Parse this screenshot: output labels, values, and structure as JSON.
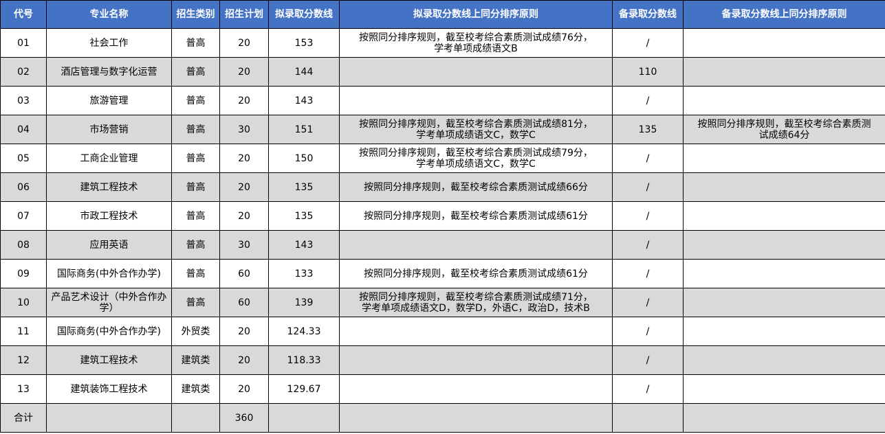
{
  "headers": [
    "代号",
    "专业名称",
    "招生类别",
    "招生计划",
    "拟录取分数线",
    "拟录取分数线上同分排序原则",
    "备录取分数线",
    "备录取分数线上同分排序原则"
  ],
  "rows": [
    {
      "code": "01",
      "major": "社会工作",
      "category": "普高",
      "plan": "20",
      "score": "153",
      "rule": [
        "按照同分排序规则，截至校考综合素质测试成绩76分，",
        "学考单项成绩语文B"
      ],
      "backup": "/",
      "backup_rule": []
    },
    {
      "code": "02",
      "major": "酒店管理与数字化运营",
      "category": "普高",
      "plan": "20",
      "score": "144",
      "rule": [],
      "backup": "110",
      "backup_rule": []
    },
    {
      "code": "03",
      "major": "旅游管理",
      "category": "普高",
      "plan": "20",
      "score": "143",
      "rule": [],
      "backup": "/",
      "backup_rule": []
    },
    {
      "code": "04",
      "major": "市场营销",
      "category": "普高",
      "plan": "30",
      "score": "151",
      "rule": [
        "按照同分排序规则，截至校考综合素质测试成绩81分，",
        "学考单项成绩语文C，数学C"
      ],
      "backup": "135",
      "backup_rule": [
        "按照同分排序规则，截至校考综合素质测",
        "试成绩64分"
      ]
    },
    {
      "code": "05",
      "major": "工商企业管理",
      "category": "普高",
      "plan": "20",
      "score": "150",
      "rule": [
        "按照同分排序规则，截至校考综合素质测试成绩79分，",
        "学考单项成绩语文C，数学C"
      ],
      "backup": "/",
      "backup_rule": []
    },
    {
      "code": "06",
      "major": "建筑工程技术",
      "category": "普高",
      "plan": "20",
      "score": "135",
      "rule": [
        "按照同分排序规则，截至校考综合素质测试成绩66分"
      ],
      "backup": "/",
      "backup_rule": []
    },
    {
      "code": "07",
      "major": "市政工程技术",
      "category": "普高",
      "plan": "20",
      "score": "135",
      "rule": [
        "按照同分排序规则，截至校考综合素质测试成绩61分"
      ],
      "backup": "/",
      "backup_rule": []
    },
    {
      "code": "08",
      "major": "应用英语",
      "category": "普高",
      "plan": "30",
      "score": "143",
      "rule": [],
      "backup": "/",
      "backup_rule": []
    },
    {
      "code": "09",
      "major": "国际商务(中外合作办学)",
      "category": "普高",
      "plan": "60",
      "score": "133",
      "rule": [
        "按照同分排序规则，截至校考综合素质测试成绩61分"
      ],
      "backup": "/",
      "backup_rule": []
    },
    {
      "code": "10",
      "major": "产品艺术设计（中外合作办学）",
      "category": "普高",
      "plan": "60",
      "score": "139",
      "rule": [
        "按照同分排序规则，截至校考综合素质测试成绩71分，",
        "学考单项成绩语文D，数学D，外语C，政治D，技术B"
      ],
      "backup": "/",
      "backup_rule": []
    },
    {
      "code": "11",
      "major": "国际商务(中外合作办学)",
      "category": "外贸类",
      "plan": "20",
      "score": "124.33",
      "rule": [],
      "backup": "/",
      "backup_rule": []
    },
    {
      "code": "12",
      "major": "建筑工程技术",
      "category": "建筑类",
      "plan": "20",
      "score": "118.33",
      "rule": [],
      "backup": "/",
      "backup_rule": []
    },
    {
      "code": "13",
      "major": "建筑装饰工程技术",
      "category": "建筑类",
      "plan": "20",
      "score": "129.67",
      "rule": [],
      "backup": "/",
      "backup_rule": []
    }
  ],
  "total": {
    "label": "合计",
    "plan": "360"
  },
  "colors": {
    "header_bg": "#4472c4",
    "header_text": "#ffffff",
    "alt_row_bg": "#d9d9d9"
  }
}
